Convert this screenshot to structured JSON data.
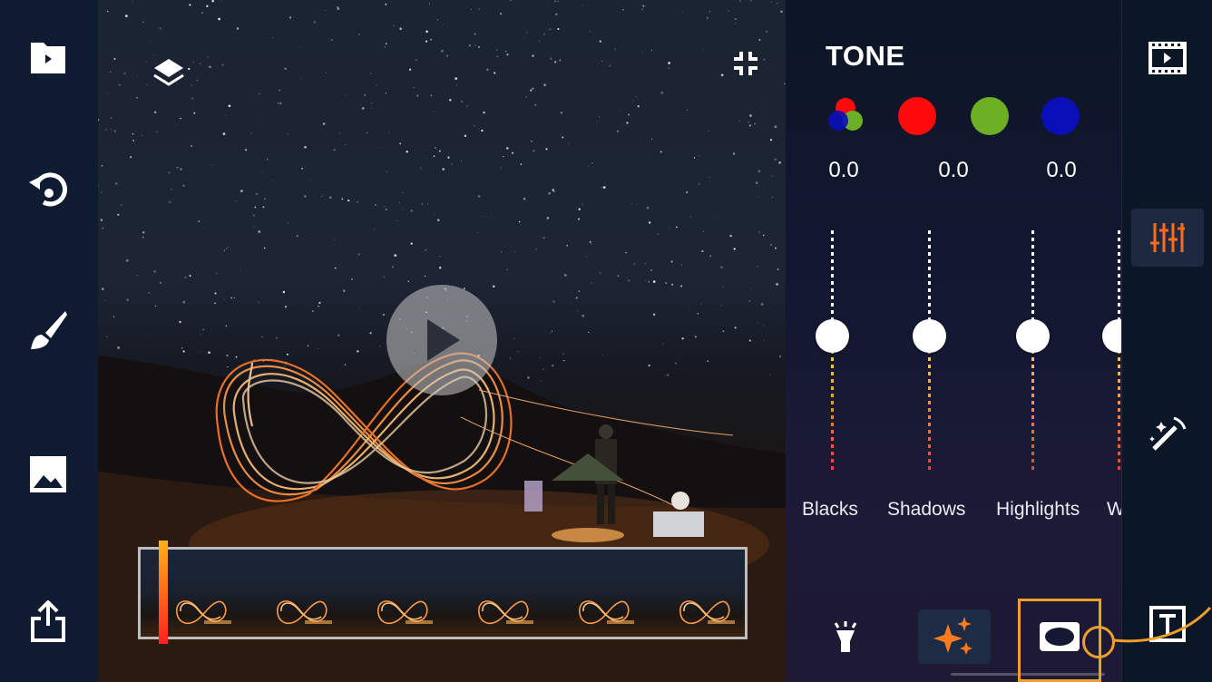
{
  "left_toolbar": {
    "items": [
      {
        "icon": "folder-play-icon"
      },
      {
        "icon": "undo-icon"
      },
      {
        "icon": "brush-icon"
      },
      {
        "icon": "image-icon"
      },
      {
        "icon": "share-icon"
      }
    ]
  },
  "canvas": {
    "layers_icon": "layers-icon",
    "exit_fullscreen_icon": "compress-icon",
    "play_icon": "play-icon"
  },
  "timeline": {
    "frame_count": 6,
    "playhead_color_top": "#ffb21e",
    "playhead_color_bottom": "#ff2020"
  },
  "tone": {
    "title": "TONE",
    "channels": [
      {
        "name": "rgb",
        "color": "#multi"
      },
      {
        "name": "red",
        "color": "#ff0a0a"
      },
      {
        "name": "green",
        "color": "#6cb024"
      },
      {
        "name": "blue",
        "color": "#0a0fb8"
      }
    ],
    "values": [
      "0.0",
      "0.0",
      "0.0"
    ],
    "sliders": [
      {
        "label": "Blacks"
      },
      {
        "label": "Shadows"
      },
      {
        "label": "Highlights"
      },
      {
        "label": "W"
      }
    ],
    "bottom_tools": [
      {
        "icon": "light-icon"
      },
      {
        "icon": "sparkle-icon"
      },
      {
        "icon": "vignette-icon"
      }
    ]
  },
  "right_toolbar": {
    "items": [
      {
        "icon": "film-icon"
      },
      {
        "icon": "adjust-sliders-icon",
        "active": true
      },
      {
        "icon": "magic-wand-icon"
      },
      {
        "icon": "text-frame-icon"
      }
    ]
  },
  "colors": {
    "accent": "#f0a02a",
    "active_icon": "#ff6a1e"
  }
}
